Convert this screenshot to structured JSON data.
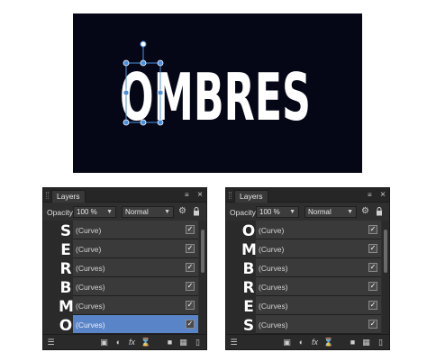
{
  "canvas": {
    "text": "OMBRES",
    "background": "#050716",
    "text_color": "#ffffff",
    "selection_color": "#4a90e2"
  },
  "panels": [
    {
      "id": "left",
      "tab_label": "Layers",
      "opacity_label": "Opacity:",
      "opacity_value": "100 %",
      "blend_mode": "Normal",
      "letters": [
        "S",
        "E",
        "R",
        "B",
        "M",
        "O"
      ],
      "rows": [
        {
          "name": "(Curve)",
          "checked": true,
          "selected": false
        },
        {
          "name": "(Curve)",
          "checked": true,
          "selected": false
        },
        {
          "name": "(Curves)",
          "checked": true,
          "selected": false
        },
        {
          "name": "(Curves)",
          "checked": true,
          "selected": false
        },
        {
          "name": "(Curves)",
          "checked": true,
          "selected": false
        },
        {
          "name": "(Curves)",
          "checked": true,
          "selected": true
        }
      ]
    },
    {
      "id": "right",
      "tab_label": "Layers",
      "opacity_label": "Opacity:",
      "opacity_value": "100 %",
      "blend_mode": "Normal",
      "letters": [
        "O",
        "M",
        "B",
        "R",
        "E",
        "S"
      ],
      "rows": [
        {
          "name": "(Curve)",
          "checked": true,
          "selected": false
        },
        {
          "name": "(Curve)",
          "checked": true,
          "selected": false
        },
        {
          "name": "(Curves)",
          "checked": true,
          "selected": false
        },
        {
          "name": "(Curves)",
          "checked": true,
          "selected": false
        },
        {
          "name": "(Curves)",
          "checked": true,
          "selected": false
        },
        {
          "name": "(Curves)",
          "checked": true,
          "selected": false
        }
      ]
    }
  ],
  "icons": {
    "panel_menu": "menu-icon",
    "close": "close-icon",
    "settings": "gear-icon",
    "lock": "lock-icon",
    "bottom": [
      "layers-stack-icon",
      "mask-icon",
      "adjustment-icon",
      "fx-icon",
      "hourglass-icon",
      "folder-icon",
      "grid-icon",
      "trash-icon"
    ]
  }
}
